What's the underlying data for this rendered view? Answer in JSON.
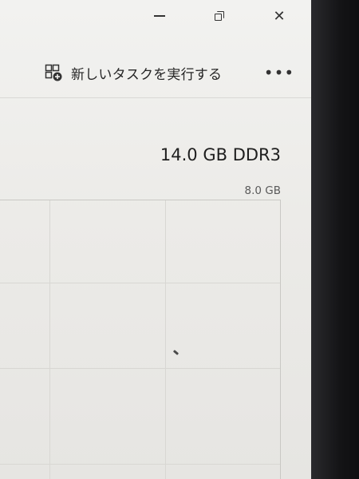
{
  "window": {
    "minimize_icon": "minimize-icon",
    "restore_icon": "restore-icon",
    "close_icon": "close-icon",
    "close_glyph": "✕"
  },
  "command_bar": {
    "run_task_icon": "new-task-icon",
    "run_task_label": "新しいタスクを実行する",
    "more_glyph": "•••"
  },
  "memory": {
    "title": "14.0 GB DDR3",
    "graph_max": "8.0 GB"
  },
  "colors": {
    "background": "#ecebe8",
    "text": "#1e1e1e",
    "grid": "#d8d7d3"
  }
}
